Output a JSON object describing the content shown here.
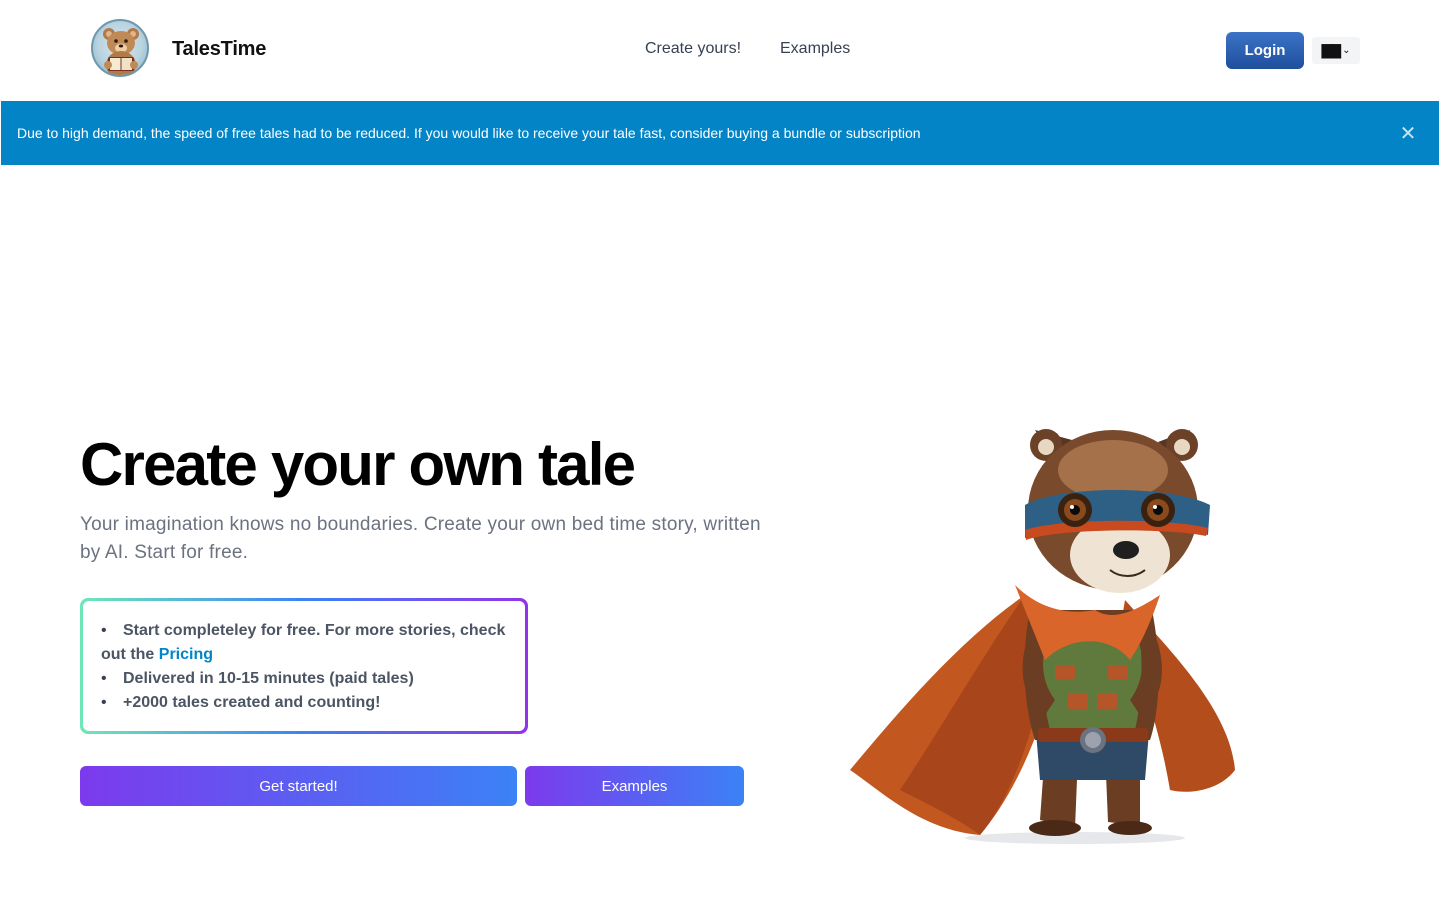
{
  "header": {
    "brand": "TalesTime",
    "nav": [
      {
        "label": "Create yours!"
      },
      {
        "label": "Examples"
      }
    ],
    "login_label": "Login",
    "language": {
      "flag_glyph": "▇▇",
      "chevron": "⌄"
    }
  },
  "banner": {
    "text": "Due to high demand, the speed of free tales had to be reduced. If you would like to receive your tale fast, consider buying a bundle or subscription",
    "close_glyph": "✕",
    "color": "#0284c7"
  },
  "hero": {
    "title": "Create your own tale",
    "subtitle": "Your imagination knows no boundaries. Create your own bed time story, written by AI. Start for free.",
    "features": [
      {
        "text": "Start completeley for free. For more stories, check out the ",
        "link": "Pricing"
      },
      {
        "text": "Delivered in 10-15 minutes (paid tales)"
      },
      {
        "text": "+2000 tales created and counting!"
      }
    ],
    "bullet": "•",
    "cta_primary": "Get started!",
    "cta_secondary": "Examples"
  },
  "colors": {
    "accent_gradient_start": "#7c3aed",
    "accent_gradient_end": "#3b82f6",
    "link": "#0284c7"
  }
}
